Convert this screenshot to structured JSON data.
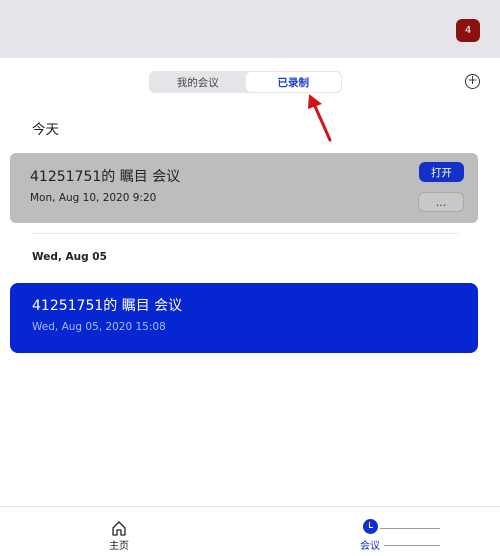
{
  "header": {
    "notification_count": "4"
  },
  "segment": {
    "tabs": [
      {
        "label": "我的会议",
        "active": false
      },
      {
        "label": "已录制",
        "active": true
      }
    ]
  },
  "icons": {
    "add": "plus-circle-icon",
    "annotation": "red-arrow",
    "home": "home-icon",
    "meetings": "clock-icon"
  },
  "colors": {
    "accent": "#1330c8",
    "highlight_card": "#0526d0",
    "badge": "#8b1010",
    "arrow": "#d0141a"
  },
  "sections": [
    {
      "heading": "今天",
      "items": [
        {
          "title": "41251751的 瞩目 会议",
          "time": "Mon, Aug 10, 2020 9:20",
          "open_label": "打开",
          "more_label": "...",
          "selected": false
        }
      ]
    },
    {
      "heading": "Wed, Aug 05",
      "items": [
        {
          "title": "41251751的 瞩目 会议",
          "time": "Wed, Aug 05, 2020 15:08",
          "selected": true
        }
      ]
    }
  ],
  "bottom_nav": [
    {
      "label": "主页",
      "icon": "home-icon",
      "active": false
    },
    {
      "label": "会议",
      "icon": "clock-icon",
      "active": true
    }
  ]
}
